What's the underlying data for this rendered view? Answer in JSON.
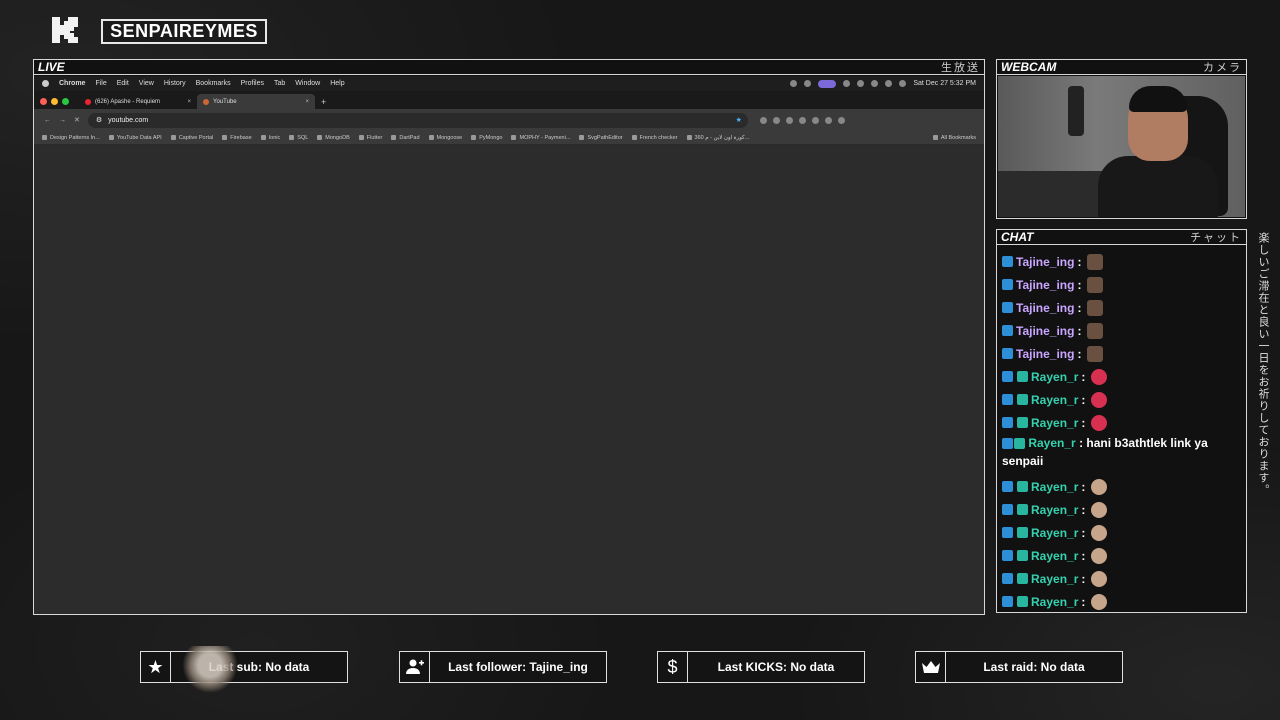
{
  "brand": {
    "name": "SENPAIREYMES"
  },
  "live": {
    "title": "LIVE",
    "jp": "生放送"
  },
  "webcam": {
    "title": "WEBCAM",
    "jp": "カメラ"
  },
  "chat": {
    "title": "CHAT",
    "jp": "チャット",
    "messages": [
      {
        "user": "Tajine_ing",
        "text": ":"
      },
      {
        "user": "Tajine_ing",
        "text": ":"
      },
      {
        "user": "Tajine_ing",
        "text": ":"
      },
      {
        "user": "Tajine_ing",
        "text": ":"
      },
      {
        "user": "Tajine_ing",
        "text": ":"
      },
      {
        "user": "Rayen_r",
        "text": ":"
      },
      {
        "user": "Rayen_r",
        "text": ":"
      },
      {
        "user": "Rayen_r",
        "text": ":"
      },
      {
        "user": "Rayen_r",
        "text": ": hani b3athtlek link ya senpaii"
      },
      {
        "user": "Rayen_r",
        "text": ":"
      },
      {
        "user": "Rayen_r",
        "text": ":"
      },
      {
        "user": "Rayen_r",
        "text": ":"
      },
      {
        "user": "Rayen_r",
        "text": ":"
      },
      {
        "user": "Rayen_r",
        "text": ":"
      },
      {
        "user": "Rayen_r",
        "text": ":"
      }
    ]
  },
  "side_text": "楽しいご滞在と良い一日をお祈りしております。",
  "browser": {
    "menubar": [
      "Chrome",
      "File",
      "Edit",
      "View",
      "History",
      "Bookmarks",
      "Profiles",
      "Tab",
      "Window",
      "Help"
    ],
    "clock": "Sat Dec 27  5:32 PM",
    "tabs": [
      {
        "title": "(626) Apashe - Requiem"
      },
      {
        "title": "YouTube"
      }
    ],
    "url": "youtube.com",
    "bookmarks": [
      "Design Patterns In...",
      "YouTube Data API",
      "Captive Portal",
      "Firebase",
      "Ionic",
      "SQL",
      "MongoDB",
      "Flutter",
      "DartPad",
      "Mongoose",
      "PyMongo",
      "MOPHY - Paymeni...",
      "SvgPathEditor",
      "French checker",
      "360 كورة اون لاين - م..."
    ],
    "all_bookmarks": "All Bookmarks"
  },
  "stats": {
    "sub": "Last sub: No data",
    "follower": "Last follower: Tajine_ing",
    "kicks": "Last KICKS: No data",
    "raid": "Last raid: No data"
  }
}
